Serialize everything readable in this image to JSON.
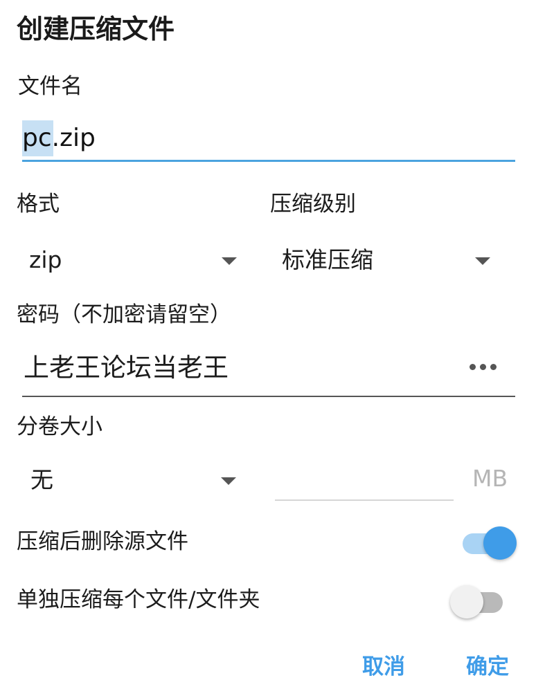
{
  "dialog": {
    "title": "创建压缩文件",
    "filename": {
      "label": "文件名",
      "value": "pc.zip",
      "selected_text": "pc"
    },
    "format": {
      "label": "格式",
      "value": "zip"
    },
    "compression_level": {
      "label": "压缩级别",
      "value": "标准压缩"
    },
    "password": {
      "label": "密码（不加密请留空）",
      "value": "上老王论坛当老王",
      "toggle_icon": "more-dots-icon"
    },
    "volume_size": {
      "label": "分卷大小",
      "value": "无",
      "size_value": "",
      "unit": "MB"
    },
    "delete_after": {
      "label": "压缩后删除源文件",
      "checked": true
    },
    "separate_each": {
      "label": "单独压缩每个文件/文件夹",
      "checked": false
    },
    "actions": {
      "cancel": "取消",
      "confirm": "确定"
    },
    "colors": {
      "accent": "#3f9ce8",
      "selection": "#c7e0f4",
      "toggle_track_on": "#a9d3f4",
      "toggle_track_off": "#b9b9b9"
    }
  }
}
